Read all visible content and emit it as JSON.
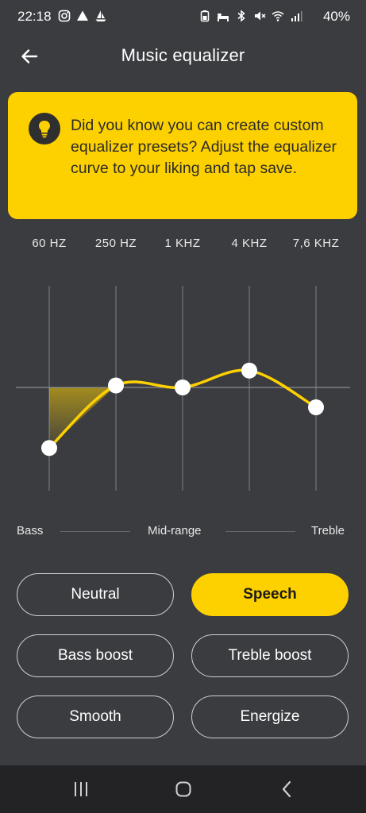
{
  "status": {
    "time": "22:18",
    "battery": "40%",
    "left_icons": [
      "instagram-icon",
      "drive-icon",
      "sailboat-icon"
    ],
    "right_icons": [
      "battery-saver-icon",
      "alarm-icon",
      "bluetooth-icon",
      "mute-icon",
      "wifi-icon",
      "signal-icon"
    ]
  },
  "header": {
    "title": "Music equalizer",
    "back_icon": "back-arrow-icon"
  },
  "tip": {
    "icon": "lightbulb-icon",
    "text": "Did you know you can create custom equalizer presets? Adjust the equalizer curve to your liking and tap save."
  },
  "frequencies": [
    "60 HZ",
    "250 HZ",
    "1 KHZ",
    "4 KHZ",
    "7,6 KHZ"
  ],
  "equalizer": {
    "accent": "#fdd000",
    "bands": [
      {
        "freq": "60 HZ",
        "level": -0.61
      },
      {
        "freq": "250 HZ",
        "level": 0.02
      },
      {
        "freq": "1 KHZ",
        "level": 0.0
      },
      {
        "freq": "4 KHZ",
        "level": 0.17
      },
      {
        "freq": "7,6 KHZ",
        "level": -0.2
      }
    ]
  },
  "ranges": {
    "bass": "Bass",
    "mid": "Mid-range",
    "treble": "Treble"
  },
  "presets": [
    {
      "label": "Neutral",
      "active": false
    },
    {
      "label": "Speech",
      "active": true
    },
    {
      "label": "Bass boost",
      "active": false
    },
    {
      "label": "Treble boost",
      "active": false
    },
    {
      "label": "Smooth",
      "active": false
    },
    {
      "label": "Energize",
      "active": false
    }
  ],
  "navbar": {
    "icons": [
      "recent-apps-icon",
      "home-icon",
      "back-icon"
    ]
  },
  "colors": {
    "background": "#3b3c40",
    "accent": "#fdd000",
    "navbar": "#232326"
  }
}
